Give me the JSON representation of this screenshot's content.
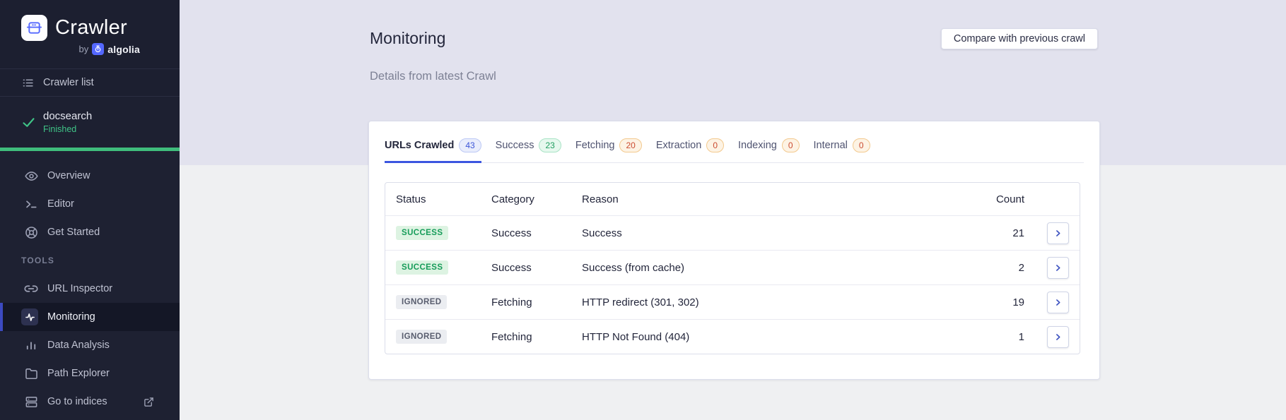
{
  "sidebar": {
    "logo": {
      "product": "Crawler",
      "by_label": "by",
      "brand": "algolia"
    },
    "crawler_list_label": "Crawler list",
    "current_crawler": {
      "name": "docsearch",
      "status": "Finished"
    },
    "nav_items": [
      {
        "label": "Overview",
        "icon": "eye-icon"
      },
      {
        "label": "Editor",
        "icon": "terminal-icon"
      },
      {
        "label": "Get Started",
        "icon": "lifebuoy-icon"
      }
    ],
    "tools_header": "TOOLS",
    "tool_items": [
      {
        "label": "URL Inspector",
        "icon": "link-icon"
      },
      {
        "label": "Monitoring",
        "icon": "activity-icon",
        "active": true
      },
      {
        "label": "Data Analysis",
        "icon": "bar-chart-icon"
      },
      {
        "label": "Path Explorer",
        "icon": "folder-icon"
      },
      {
        "label": "Go to indices",
        "icon": "server-icon",
        "external": true
      }
    ]
  },
  "header": {
    "title": "Monitoring",
    "subtitle": "Details from latest Crawl",
    "compare_button_label": "Compare with previous crawl"
  },
  "tabs": [
    {
      "label": "URLs Crawled",
      "count": "43",
      "badge_color": "blue",
      "active": true
    },
    {
      "label": "Success",
      "count": "23",
      "badge_color": "green",
      "active": false
    },
    {
      "label": "Fetching",
      "count": "20",
      "badge_color": "orange",
      "active": false
    },
    {
      "label": "Extraction",
      "count": "0",
      "badge_color": "orange",
      "active": false
    },
    {
      "label": "Indexing",
      "count": "0",
      "badge_color": "orange",
      "active": false
    },
    {
      "label": "Internal",
      "count": "0",
      "badge_color": "orange",
      "active": false
    }
  ],
  "table": {
    "columns": {
      "status": "Status",
      "category": "Category",
      "reason": "Reason",
      "count": "Count"
    },
    "rows": [
      {
        "status": "SUCCESS",
        "variant": "success",
        "category": "Success",
        "reason": "Success",
        "count": "21"
      },
      {
        "status": "SUCCESS",
        "variant": "success",
        "category": "Success",
        "reason": "Success (from cache)",
        "count": "2"
      },
      {
        "status": "IGNORED",
        "variant": "ignored",
        "category": "Fetching",
        "reason": "HTTP redirect (301, 302)",
        "count": "19"
      },
      {
        "status": "IGNORED",
        "variant": "ignored",
        "category": "Fetching",
        "reason": "HTTP Not Found (404)",
        "count": "1"
      }
    ]
  },
  "colors": {
    "accent_blue": "#3c56e0",
    "success_green": "#169c59",
    "progress_green": "#3fbd7c",
    "warning_orange": "#cb4b31",
    "sidebar_bg": "#1e2132",
    "header_band_bg": "#e2e2ee",
    "content_bg": "#eff0f2",
    "brand_blue": "#5468ff"
  }
}
